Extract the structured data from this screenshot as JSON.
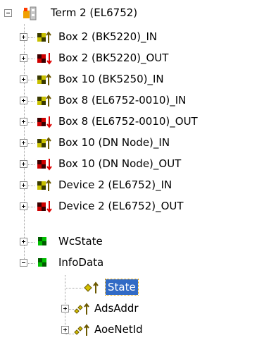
{
  "tree": {
    "root": {
      "label": "Term 2 (EL6752)",
      "icon": "terminal-icon",
      "expanded": true
    },
    "items": [
      {
        "label": "Box 2 (BK5220)_IN",
        "icon": "input-variable-icon",
        "expanded": false
      },
      {
        "label": "Box 2 (BK5220)_OUT",
        "icon": "output-variable-icon",
        "expanded": false
      },
      {
        "label": "Box 10 (BK5250)_IN",
        "icon": "input-variable-icon",
        "expanded": false
      },
      {
        "label": "Box 8 (EL6752-0010)_IN",
        "icon": "input-variable-icon",
        "expanded": false
      },
      {
        "label": "Box 8 (EL6752-0010)_OUT",
        "icon": "output-variable-icon",
        "expanded": false
      },
      {
        "label": "Box 10 (DN Node)_IN",
        "icon": "input-variable-icon",
        "expanded": false
      },
      {
        "label": "Box 10 (DN Node)_OUT",
        "icon": "output-variable-icon",
        "expanded": false
      },
      {
        "label": "Device 2 (EL6752)_IN",
        "icon": "input-variable-icon",
        "expanded": false
      },
      {
        "label": "Device 2 (EL6752)_OUT",
        "icon": "output-variable-icon",
        "expanded": false
      },
      {
        "label": "WcState",
        "icon": "status-variable-icon",
        "expanded": false
      },
      {
        "label": "InfoData",
        "icon": "status-variable-icon",
        "expanded": true,
        "children": [
          {
            "label": "State",
            "icon": "single-input-icon",
            "selected": true
          },
          {
            "label": "AdsAddr",
            "icon": "multi-input-icon",
            "expanded": false
          },
          {
            "label": "AoeNetId",
            "icon": "multi-input-icon",
            "expanded": false
          }
        ]
      }
    ]
  },
  "colors": {
    "selection": "#316ac5",
    "input_arrow": "#d4c000",
    "output_arrow": "#e00000",
    "green_box": "#00b000"
  }
}
